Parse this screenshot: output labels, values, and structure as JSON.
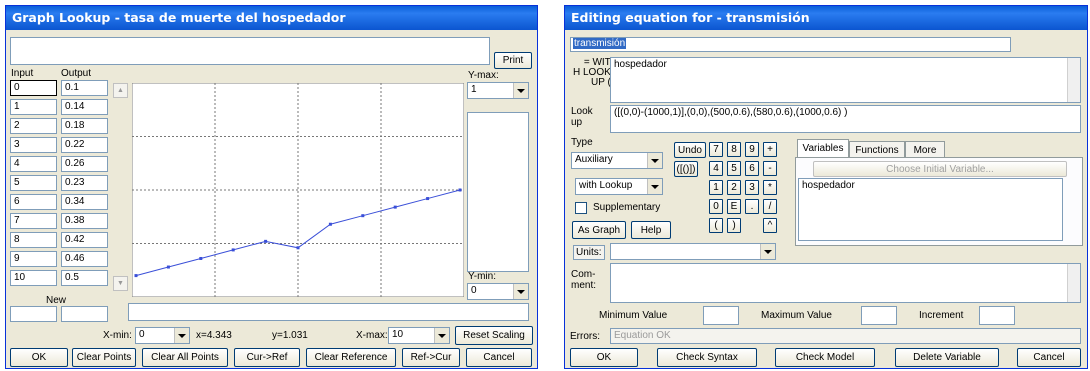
{
  "left": {
    "title": "Graph Lookup - tasa de muerte del hospedador",
    "print_label": "Print",
    "input_header": "Input",
    "output_header": "Output",
    "inputs": [
      "0",
      "1",
      "2",
      "3",
      "4",
      "5",
      "6",
      "7",
      "8",
      "9",
      "10"
    ],
    "outputs": [
      "0.1",
      "0.14",
      "0.18",
      "0.22",
      "0.26",
      "0.23",
      "0.34",
      "0.38",
      "0.42",
      "0.46",
      "0.5"
    ],
    "new_label": "New",
    "ymax_label": "Y-max:",
    "ymax_value": "1",
    "ymin_label": "Y-min:",
    "ymin_value": "0",
    "xmin_label": "X-min:",
    "xmin_value": "0",
    "xreadout": "x=4.343",
    "yreadout": "y=1.031",
    "xmax_label": "X-max:",
    "xmax_value": "10",
    "reset_label": "Reset Scaling",
    "buttons": {
      "ok": "OK",
      "clear_points": "Clear Points",
      "clear_all": "Clear All Points",
      "cur_ref": "Cur->Ref",
      "clear_ref": "Clear Reference",
      "ref_cur": "Ref->Cur",
      "cancel": "Cancel"
    },
    "chart_data": {
      "type": "line",
      "x": [
        0,
        1,
        2,
        3,
        4,
        5,
        6,
        7,
        8,
        9,
        10
      ],
      "y": [
        0.1,
        0.14,
        0.18,
        0.22,
        0.26,
        0.23,
        0.34,
        0.38,
        0.42,
        0.46,
        0.5
      ],
      "xlim": [
        0,
        10
      ],
      "ylim": [
        0,
        1
      ],
      "grid": true,
      "color": "#3a4fd8"
    }
  },
  "right": {
    "title": "Editing equation for - transmisión",
    "var_name": "transmisión",
    "eq_label_1": "= WIT",
    "eq_label_2": "H LOOK",
    "eq_label_3": "UP (",
    "eq_value": "hospedador",
    "lookup_label_1": "Look",
    "lookup_label_2": "up",
    "lookup_value": "([(0,0)-(1000,1)],(0,0),(500,0.6),(580,0.6),(1000,0.6) )",
    "type_label": "Type",
    "type_value": "Auxiliary",
    "subtype_value": "with Lookup",
    "supplementary_label": "Supplementary",
    "undo_label": "Undo",
    "paren_btn": "([()])",
    "as_graph": "As Graph",
    "help": "Help",
    "calc_keys": [
      "7",
      "8",
      "9",
      "+",
      "4",
      "5",
      "6",
      "-",
      "1",
      "2",
      "3",
      "*",
      "0",
      "E",
      ".",
      "/",
      "(",
      ")",
      "",
      "^"
    ],
    "tabs": [
      "Variables",
      "Functions",
      "More"
    ],
    "choose_initial": "Choose Initial Variable...",
    "variables": [
      "hospedador"
    ],
    "units_label": "Units:",
    "comment_label_1": "Com-",
    "comment_label_2": "ment:",
    "min_label": "Minimum Value",
    "max_label": "Maximum Value",
    "inc_label": "Increment",
    "errors_label": "Errors:",
    "errors_value": "Equation OK",
    "buttons": {
      "ok": "OK",
      "check_syntax": "Check Syntax",
      "check_model": "Check Model",
      "delete_var": "Delete Variable",
      "cancel": "Cancel"
    }
  }
}
